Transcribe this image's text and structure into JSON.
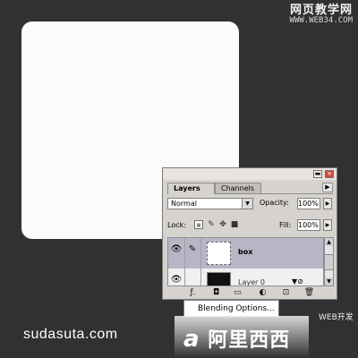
{
  "watermark_top": {
    "chinese": "网页教学网",
    "url": "WWW.WEB34.COM"
  },
  "credit": "sudasuta.com",
  "panel": {
    "tabs": [
      "Layers",
      "Channels"
    ],
    "blend_mode": "Normal",
    "opacity_label": "Opacity:",
    "opacity_value": "100%",
    "lock_label": "Lock:",
    "fill_label": "Fill:",
    "fill_value": "100%",
    "layers": [
      {
        "name": "box",
        "selected": true,
        "thumbnail": "transparent"
      },
      {
        "name": "Layer 0",
        "selected": false,
        "thumbnail": "black"
      }
    ]
  },
  "context_menu": {
    "items": [
      "Blending Options..."
    ]
  },
  "watermark_bottom": {
    "web_dev": "WEB开发",
    "logo": "阿里西西"
  }
}
